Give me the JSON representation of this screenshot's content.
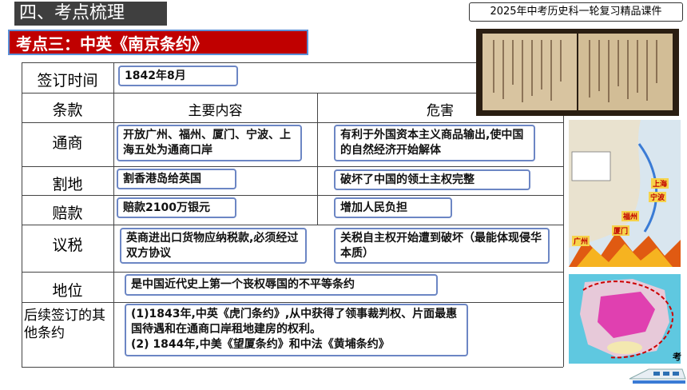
{
  "header": {
    "section_title": "四、考点梳理",
    "brand_label": "2025年中考历史科一轮复习精品课件",
    "topic_title": "考点三：中英《南京条约》"
  },
  "table": {
    "sign_time_label": "签订时间",
    "sign_time_value": "1842年8月",
    "col_clause": "条款",
    "col_content": "主要内容",
    "col_harm": "危害",
    "rows": [
      {
        "label": "通商",
        "content": "开放广州、福州、厦门、宁波、上海五处为通商口岸",
        "harm": "有利于外国资本主义商品输出,使中国的自然经济开始解体"
      },
      {
        "label": "割地",
        "content": "割香港岛给英国",
        "harm": "破坏了中国的领土主权完整"
      },
      {
        "label": "赔款",
        "content": "赔款2100万银元",
        "harm": "增加人民负担"
      },
      {
        "label": "议税",
        "content": "英商进出口货物应纳税款,必须经过双方协议",
        "harm": "关税自主权开始遭到破坏（最能体现侵华本质）"
      }
    ],
    "status_label": "地位",
    "status_value": "是中国近代史上第一个丧权辱国的不平等条约",
    "later_label": "后续签订的其他条约",
    "later_line1": "(1)1843年,中英《虎门条约》,从中获得了领事裁判权、片面最惠国待遇和在通商口岸租地建房的权利。",
    "later_line2": "(2) 1844年,中美《望厦条约》和中法《黄埔条约》"
  },
  "map": {
    "labels": [
      "上海",
      "宁波",
      "福州",
      "厦门",
      "广州"
    ]
  },
  "corner_label": "考"
}
